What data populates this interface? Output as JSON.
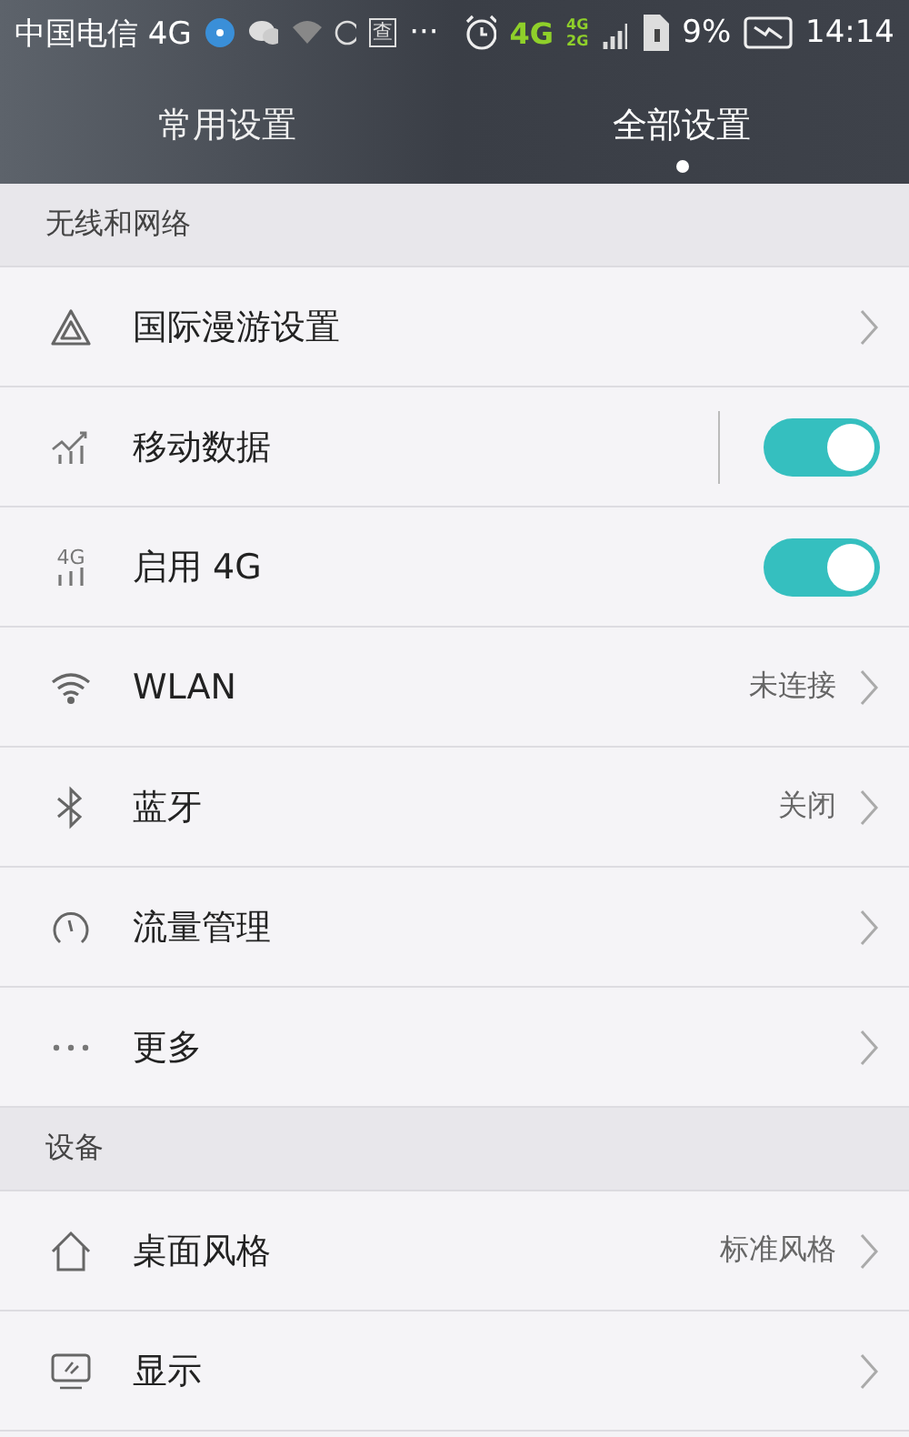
{
  "status_bar": {
    "carrier": "中国电信 4G",
    "notification_text": "查",
    "overflow": "···",
    "network_type": "4G",
    "sim_types": [
      "4G",
      "2G"
    ],
    "battery": "9%",
    "time": "14:14"
  },
  "tabs": [
    {
      "label": "常用设置",
      "selected": false
    },
    {
      "label": "全部设置",
      "selected": true
    }
  ],
  "sections": [
    {
      "title": "无线和网络",
      "rows": [
        {
          "kind": "link",
          "label": "国际漫游设置"
        },
        {
          "kind": "toggle",
          "label": "移动数据",
          "on": true,
          "divider": true
        },
        {
          "kind": "toggle",
          "icon_text": "4G",
          "label": "启用 4G",
          "on": true,
          "divider": false
        },
        {
          "kind": "link",
          "label": "WLAN",
          "value": "未连接"
        },
        {
          "kind": "link",
          "label": "蓝牙",
          "value": "关闭"
        },
        {
          "kind": "link",
          "label": "流量管理"
        },
        {
          "kind": "link",
          "label": "更多"
        }
      ]
    },
    {
      "title": "设备",
      "rows": [
        {
          "kind": "link",
          "label": "桌面风格",
          "value": "标准风格"
        },
        {
          "kind": "link",
          "label": "显示"
        }
      ]
    }
  ]
}
